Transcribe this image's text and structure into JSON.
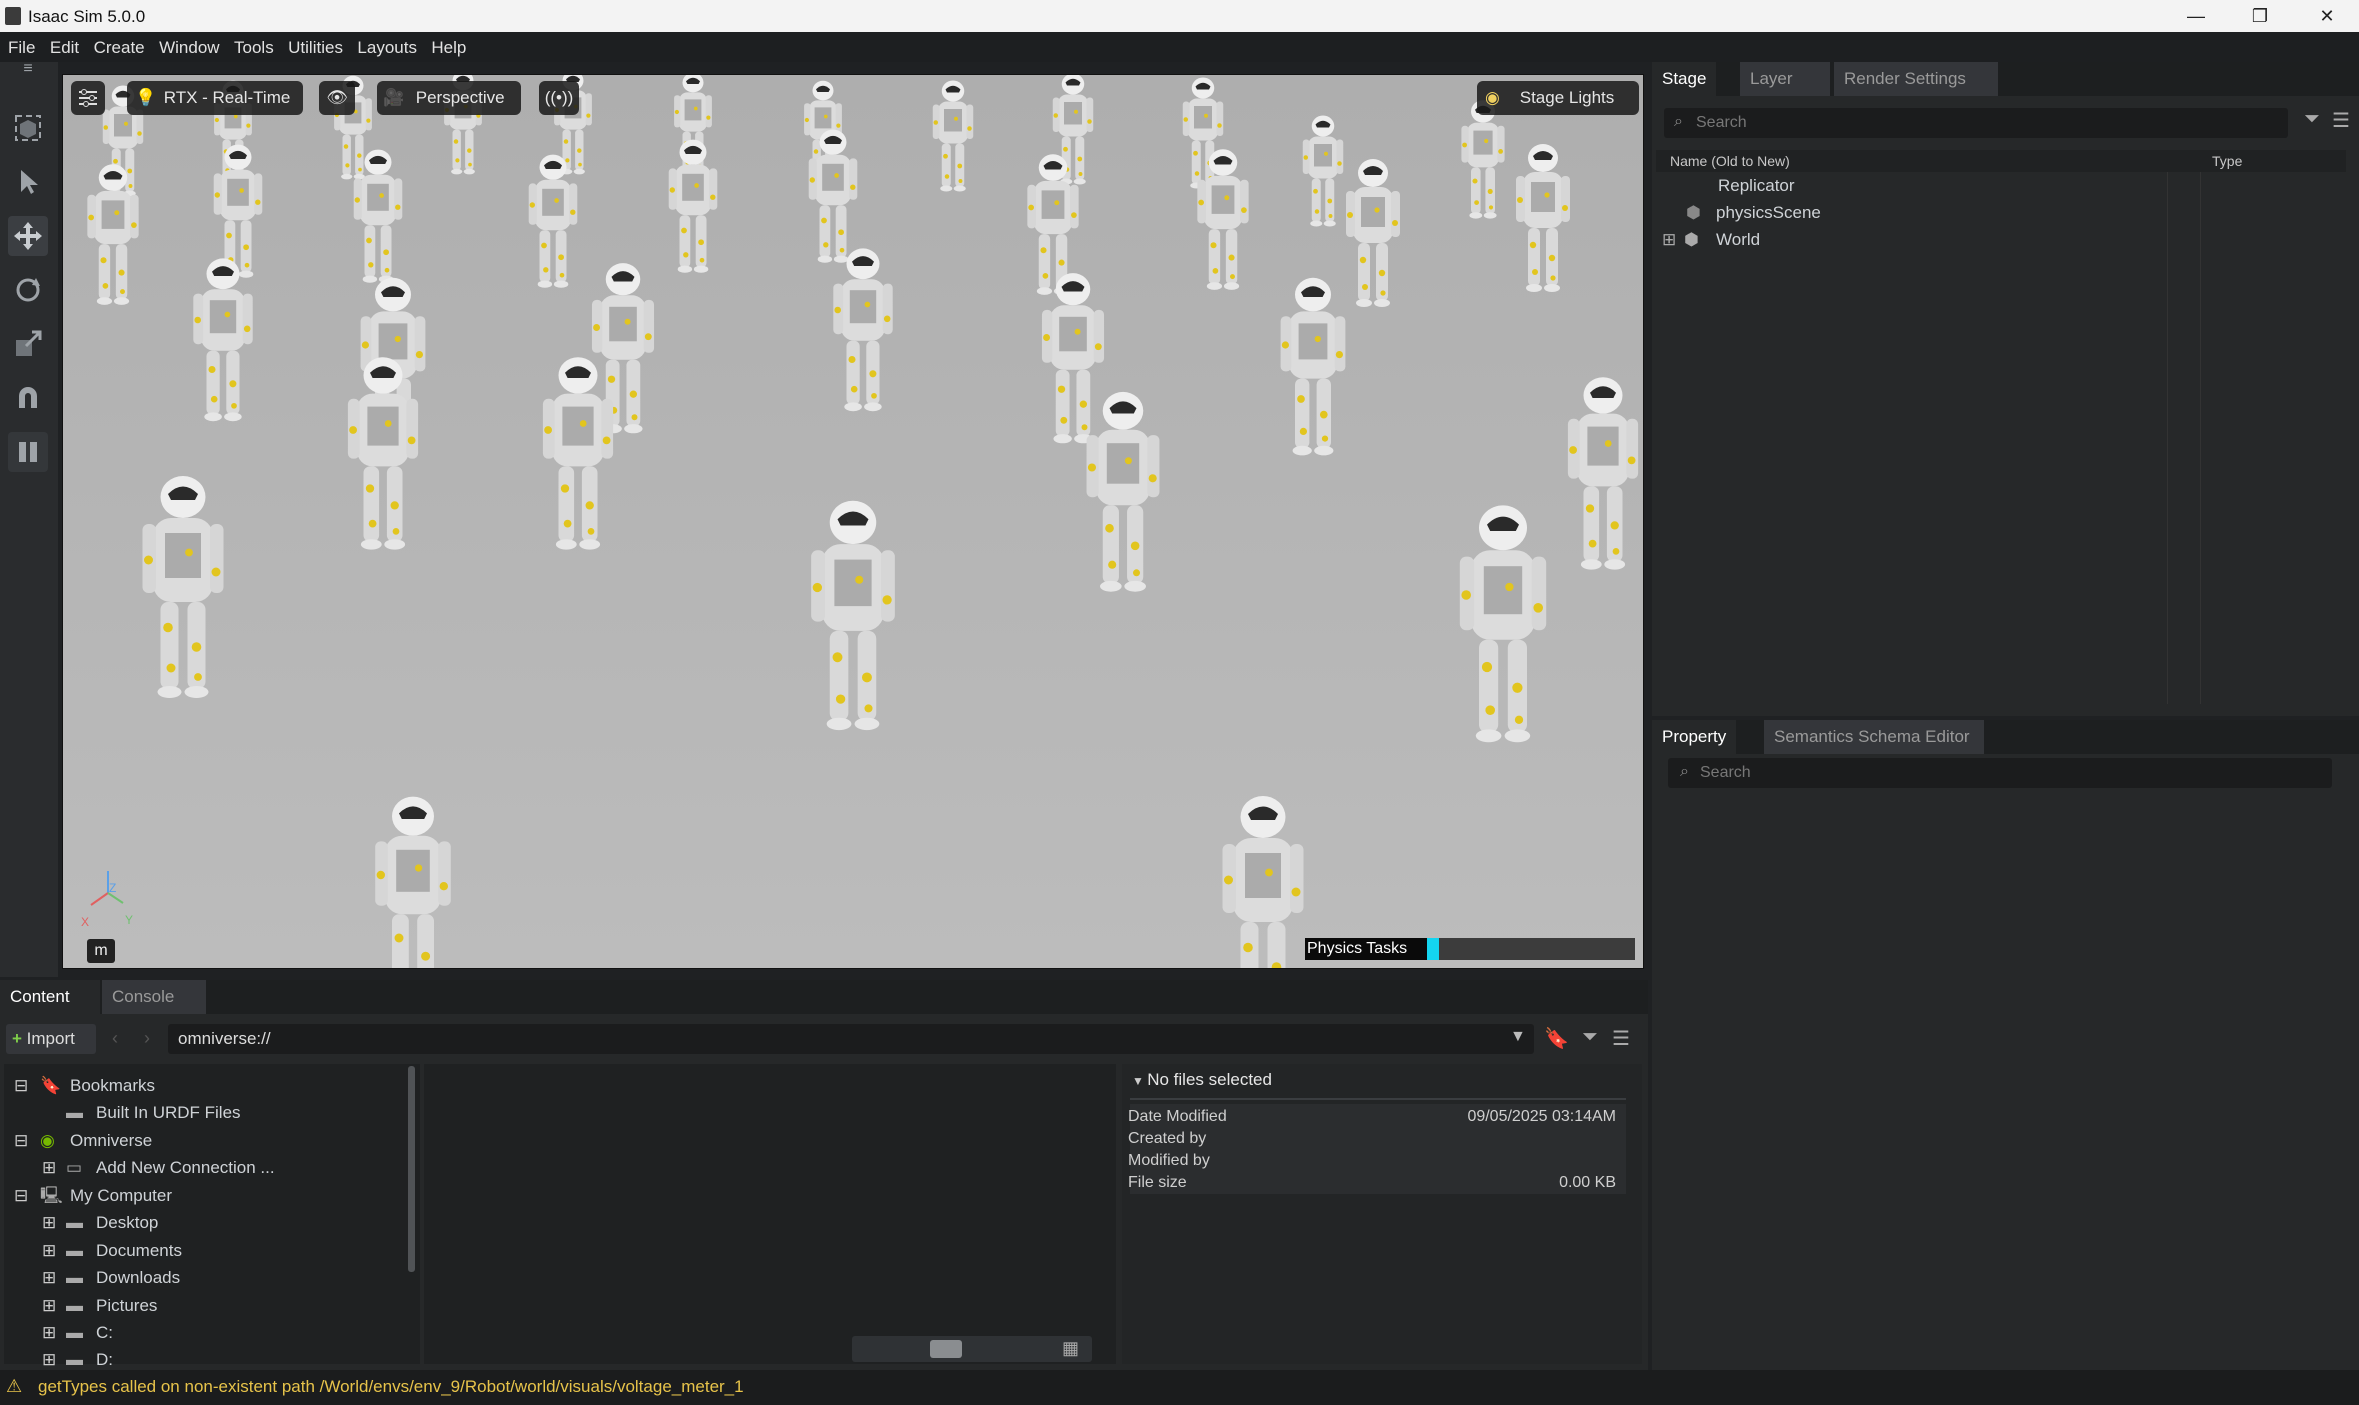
{
  "window": {
    "title": "Isaac Sim 5.0.0",
    "minimize": "—",
    "maximize": "❐",
    "close": "✕"
  },
  "menu": [
    "File",
    "Edit",
    "Create",
    "Window",
    "Tools",
    "Utilities",
    "Layouts",
    "Help"
  ],
  "viewport": {
    "renderer": "RTX - Real-Time",
    "camera": "Perspective",
    "stage_lights": "Stage Lights",
    "units_label": "m",
    "physics_tasks_label": "Physics Tasks",
    "physics_tasks_progress": 0.06,
    "axes": {
      "z": "Z",
      "x": "X",
      "y": "Y"
    }
  },
  "stage": {
    "tabs": [
      "Stage",
      "Layer",
      "Render Settings"
    ],
    "search_placeholder": "Search",
    "columns": [
      "Name (Old to New)",
      "Type"
    ],
    "items": [
      {
        "name": "Replicator"
      },
      {
        "name": "physicsScene"
      },
      {
        "name": "World"
      }
    ]
  },
  "property": {
    "tabs": [
      "Property",
      "Semantics Schema Editor"
    ],
    "search_placeholder": "Search"
  },
  "content": {
    "tabs": [
      "Content",
      "Console"
    ],
    "import_label": "Import",
    "path": "omniverse://",
    "tree": [
      {
        "label": "Bookmarks"
      },
      {
        "label": "Built In URDF Files"
      },
      {
        "label": "Omniverse"
      },
      {
        "label": "Add New Connection ..."
      },
      {
        "label": "My Computer"
      },
      {
        "label": "Desktop"
      },
      {
        "label": "Documents"
      },
      {
        "label": "Downloads"
      },
      {
        "label": "Pictures"
      },
      {
        "label": "C:"
      },
      {
        "label": "D:"
      }
    ],
    "details": {
      "header": "No files selected",
      "rows": [
        {
          "label": "Date Modified",
          "value": "09/05/2025 03:14AM"
        },
        {
          "label": "Created by",
          "value": ""
        },
        {
          "label": "Modified by",
          "value": ""
        },
        {
          "label": "File size",
          "value": "0.00 KB"
        }
      ]
    }
  },
  "status": {
    "message": "getTypes called on non-existent path /World/envs/env_9/Robot/world/visuals/voltage_meter_1"
  },
  "colors": {
    "accent": "#14d4f0",
    "warning": "#e7c34a",
    "viewport_bg": "#b6b6b6",
    "panel": "#262829"
  }
}
